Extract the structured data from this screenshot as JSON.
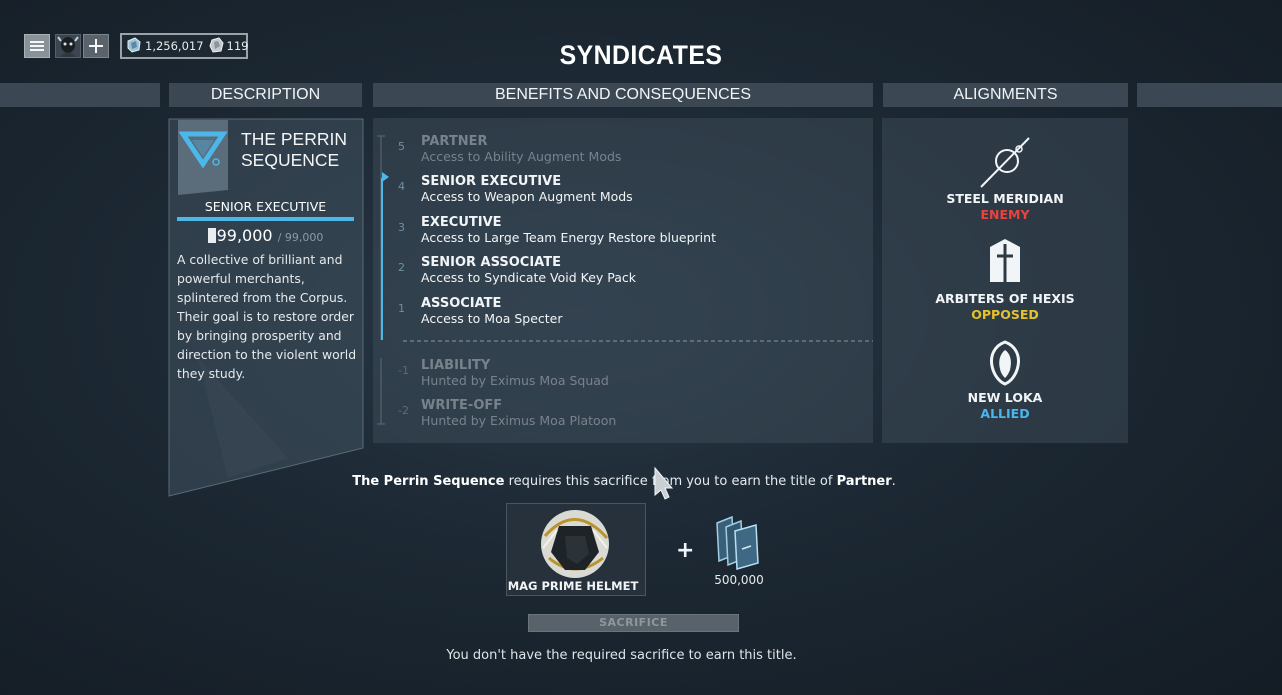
{
  "page": {
    "title": "SYNDICATES"
  },
  "currency": {
    "credits": "1,256,017",
    "platinum": "119"
  },
  "headers": {
    "description": "DESCRIPTION",
    "benefits": "BENEFITS AND CONSEQUENCES",
    "alignments": "ALIGNMENTS"
  },
  "syndicate": {
    "name": "THE PERRIN SEQUENCE",
    "rank": "SENIOR EXECUTIVE",
    "rank_progress": 1.0,
    "standing": "99,000",
    "standing_max": "/ 99,000",
    "description": "A collective of brilliant and powerful merchants, splintered from the Corpus. Their goal is to restore order by bringing prosperity and direction to the violent world they study.",
    "accent_color": "#4cb8ea"
  },
  "ranks": [
    {
      "num": "5",
      "title": "PARTNER",
      "benefit": "Access to Ability Augment Mods",
      "state": "locked"
    },
    {
      "num": "4",
      "title": "SENIOR EXECUTIVE",
      "benefit": "Access to Weapon Augment Mods",
      "state": "current"
    },
    {
      "num": "3",
      "title": "EXECUTIVE",
      "benefit": "Access to Large Team Energy Restore blueprint",
      "state": "achieved"
    },
    {
      "num": "2",
      "title": "SENIOR ASSOCIATE",
      "benefit": "Access to Syndicate Void Key Pack",
      "state": "achieved"
    },
    {
      "num": "1",
      "title": "ASSOCIATE",
      "benefit": "Access to Moa Specter",
      "state": "achieved"
    },
    {
      "num": "-1",
      "title": "LIABILITY",
      "benefit": "Hunted by Eximus Moa Squad",
      "state": "negative"
    },
    {
      "num": "-2",
      "title": "WRITE-OFF",
      "benefit": "Hunted by Eximus Moa Platoon",
      "state": "negative"
    }
  ],
  "alignments": [
    {
      "name": "STEEL MERIDIAN",
      "status": "ENEMY",
      "status_color": "#e8433f",
      "icon": "steel-meridian-icon"
    },
    {
      "name": "ARBITERS OF HEXIS",
      "status": "OPPOSED",
      "status_color": "#e5c22c",
      "icon": "arbiters-of-hexis-icon"
    },
    {
      "name": "NEW LOKA",
      "status": "ALLIED",
      "status_color": "#49b6ee",
      "icon": "new-loka-icon"
    }
  ],
  "sacrifice": {
    "syndicate_name": "The Perrin Sequence",
    "text_middle": " requires this sacrifice from you to earn the title of ",
    "next_title": "Partner",
    "text_end": ".",
    "item_name": "MAG PRIME HELMET",
    "standing_cost": "500,000",
    "button_label": "SACRIFICE",
    "message": "You don't have the required sacrifice to earn this title."
  }
}
